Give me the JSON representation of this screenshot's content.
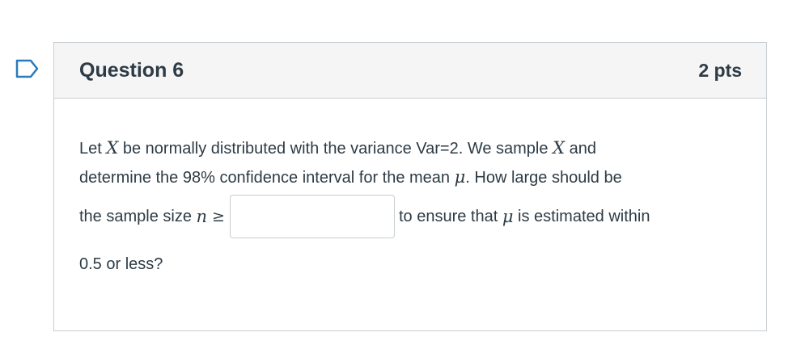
{
  "question": {
    "title": "Question 6",
    "points": "2 pts"
  },
  "body": {
    "line1_a": "Let ",
    "var_x": "X",
    "line1_b": " be normally distributed with the variance Var=2. We sample ",
    "line1_c": " and",
    "line2_a": "determine the 98% confidence interval for the mean ",
    "mu": "μ",
    "line2_b": ". How large should be",
    "line3_a": "the sample size ",
    "var_n": "n",
    "geq": "≥",
    "line3_b": "to ensure that ",
    "line3_c": " is estimated within",
    "line4": "0.5 or less?"
  },
  "answer": {
    "value": "",
    "placeholder": ""
  },
  "colors": {
    "flag_outline": "#2b7abc",
    "header_bg": "#f5f5f5",
    "border": "#c7cdd1",
    "text": "#2d3b45"
  },
  "icons": {
    "flag": "bookmark-flag-icon"
  }
}
